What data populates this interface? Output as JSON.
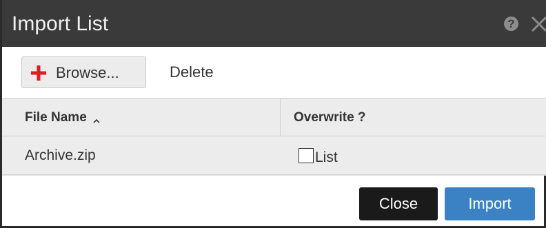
{
  "dialog": {
    "title": "Import List",
    "help_icon_glyph": "?",
    "help_icon": "question-circle-icon",
    "close_icon": "close-icon"
  },
  "toolbar": {
    "browse_label": "Browse...",
    "browse_icon": "plus-icon",
    "browse_icon_color": "#e31b23",
    "delete_label": "Delete"
  },
  "table": {
    "columns": [
      {
        "label": "File Name",
        "sort": "ascending"
      },
      {
        "label": "Overwrite ?"
      }
    ],
    "rows": [
      {
        "file_name": "Archive.zip",
        "overwrite_label": "List",
        "overwrite_checked": false
      }
    ]
  },
  "footer": {
    "close_label": "Close",
    "import_label": "Import"
  },
  "colors": {
    "titlebar": "#3a3a3a",
    "primary_button": "#3b82c4",
    "dark_button": "#1a1a1a"
  }
}
